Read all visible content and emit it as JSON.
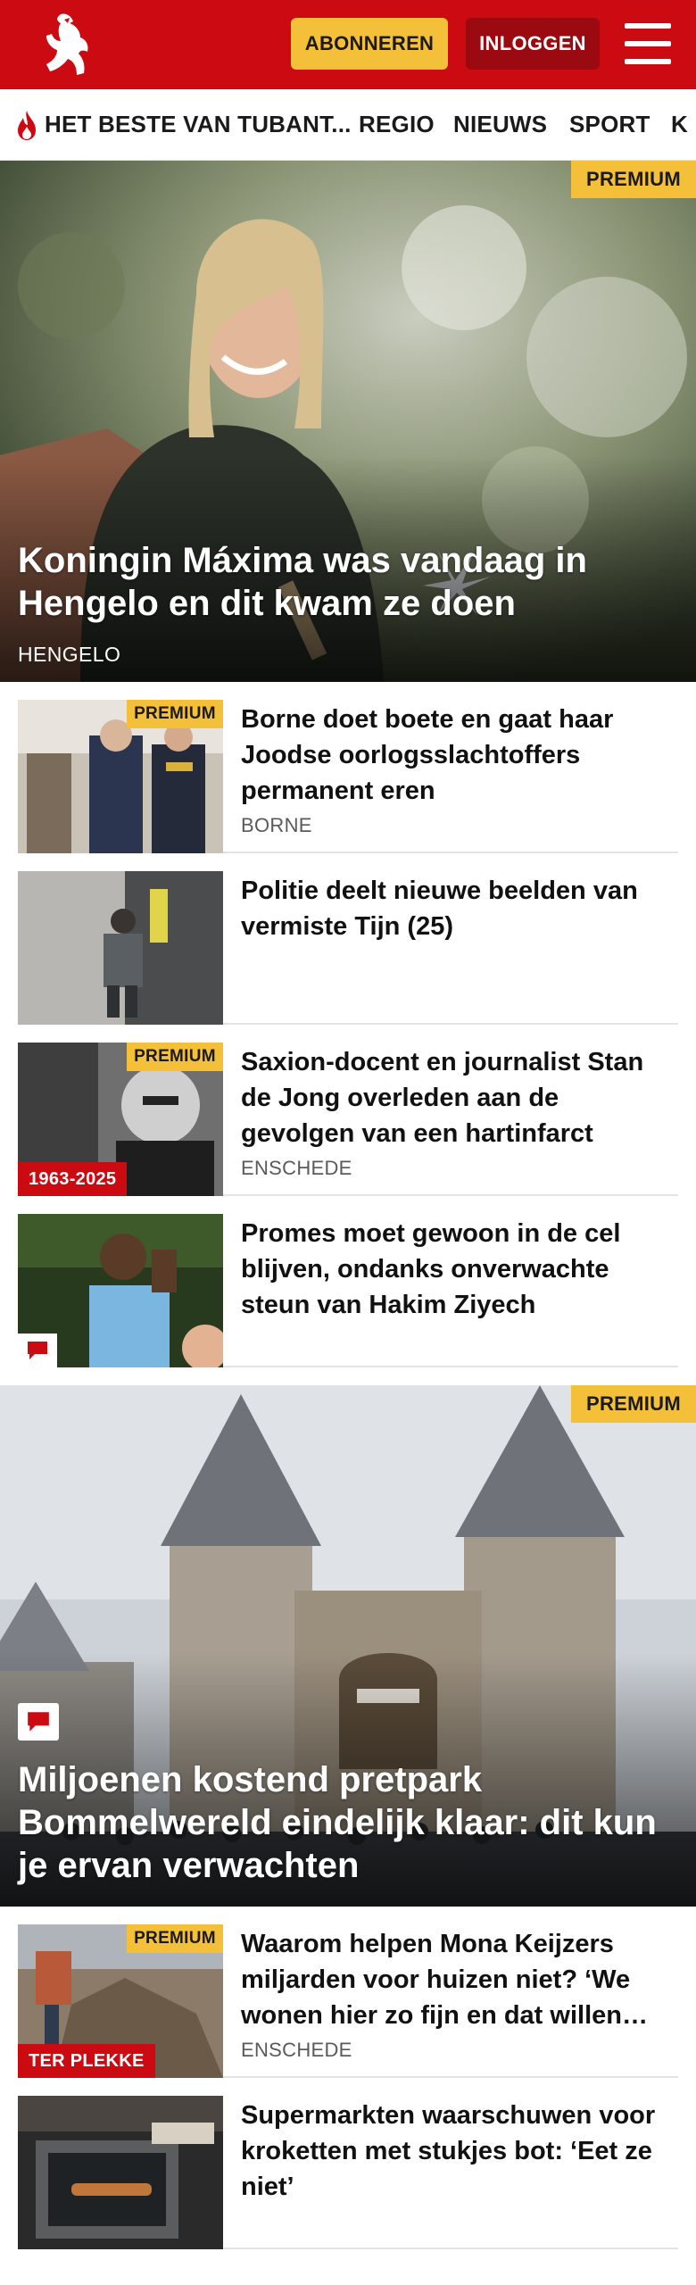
{
  "header": {
    "subscribe_label": "ABONNEREN",
    "login_label": "INLOGGEN",
    "brand_color": "#cc0a11",
    "accent_color": "#f4c03a"
  },
  "nav": {
    "items": [
      "HET BESTE VAN TUBANT...",
      "REGIO",
      "NIEUWS",
      "SPORT",
      "K"
    ]
  },
  "premium_label": "PREMIUM",
  "hero1": {
    "title": "Koningin Máxima was vandaag in Hengelo en dit kwam ze doen",
    "location": "HENGELO",
    "premium": true
  },
  "articles1": [
    {
      "title": "Borne doet boete en gaat haar Joodse oorlogsslachtoffers permanent eren",
      "location": "BORNE",
      "premium": true
    },
    {
      "title": "Politie deelt nieuwe beelden van vermiste Tijn (25)",
      "location": "",
      "premium": false
    },
    {
      "title": "Saxion-docent en journalist Stan de Jong overleden aan de gevolgen van een hartinfarct",
      "location": "ENSCHEDE",
      "premium": true,
      "thumb_label": "1963-2025"
    },
    {
      "title": "Promes moet gewoon in de cel blijven, ondanks onverwachte steun van Hakim Ziyech",
      "location": "",
      "premium": false,
      "comments": true
    }
  ],
  "hero2": {
    "title": "Miljoenen kostend pretpark Bommelwereld eindelijk klaar: dit kun je ervan verwachten",
    "premium": true,
    "comments": true
  },
  "articles2": [
    {
      "title": "Waarom helpen Mona Keijzers miljarden voor huizen niet? ‘We wonen hier zo fijn en dat willen…",
      "location": "ENSCHEDE",
      "premium": true,
      "thumb_label": "TER PLEKKE"
    },
    {
      "title": "Supermarkten waarschuwen voor kroketten met stukjes bot: ‘Eet ze niet’",
      "location": "",
      "premium": false
    }
  ]
}
